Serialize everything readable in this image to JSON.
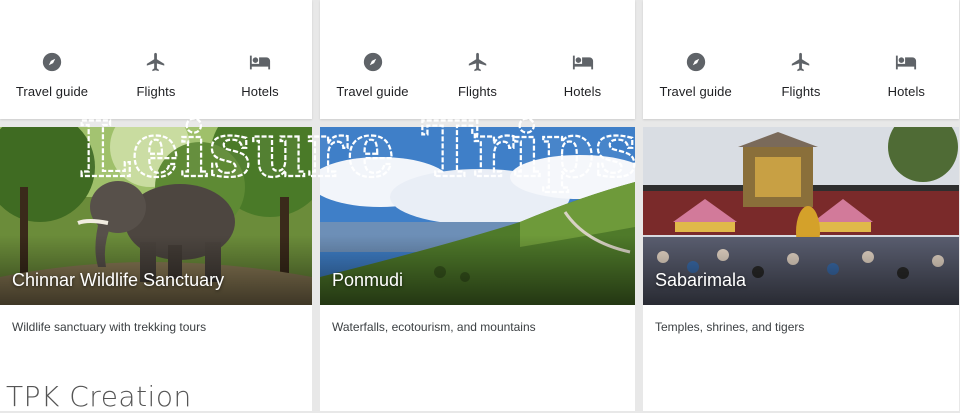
{
  "columns": [
    {
      "actions": [
        {
          "label": "Travel guide",
          "icon": "compass-icon"
        },
        {
          "label": "Flights",
          "icon": "airplane-icon"
        },
        {
          "label": "Hotels",
          "icon": "bed-icon"
        }
      ],
      "place": "Chinnar Wildlife Sanctuary",
      "description": "Wildlife sanctuary with trekking tours"
    },
    {
      "actions": [
        {
          "label": "Travel guide",
          "icon": "compass-icon"
        },
        {
          "label": "Flights",
          "icon": "airplane-icon"
        },
        {
          "label": "Hotels",
          "icon": "bed-icon"
        }
      ],
      "place": "Ponmudi",
      "description": "Waterfalls, ecotourism, and mountains"
    },
    {
      "actions": [
        {
          "label": "Travel guide",
          "icon": "compass-icon"
        },
        {
          "label": "Flights",
          "icon": "airplane-icon"
        },
        {
          "label": "Hotels",
          "icon": "bed-icon"
        }
      ],
      "place": "Sabarimala",
      "description": "Temples, shrines, and tigers"
    }
  ],
  "watermark_title": "Leisure Trips",
  "credit": "TPK Creation",
  "colors": {
    "icon": "#5f6368",
    "text": "#202124",
    "background": "#e8e8e8"
  }
}
